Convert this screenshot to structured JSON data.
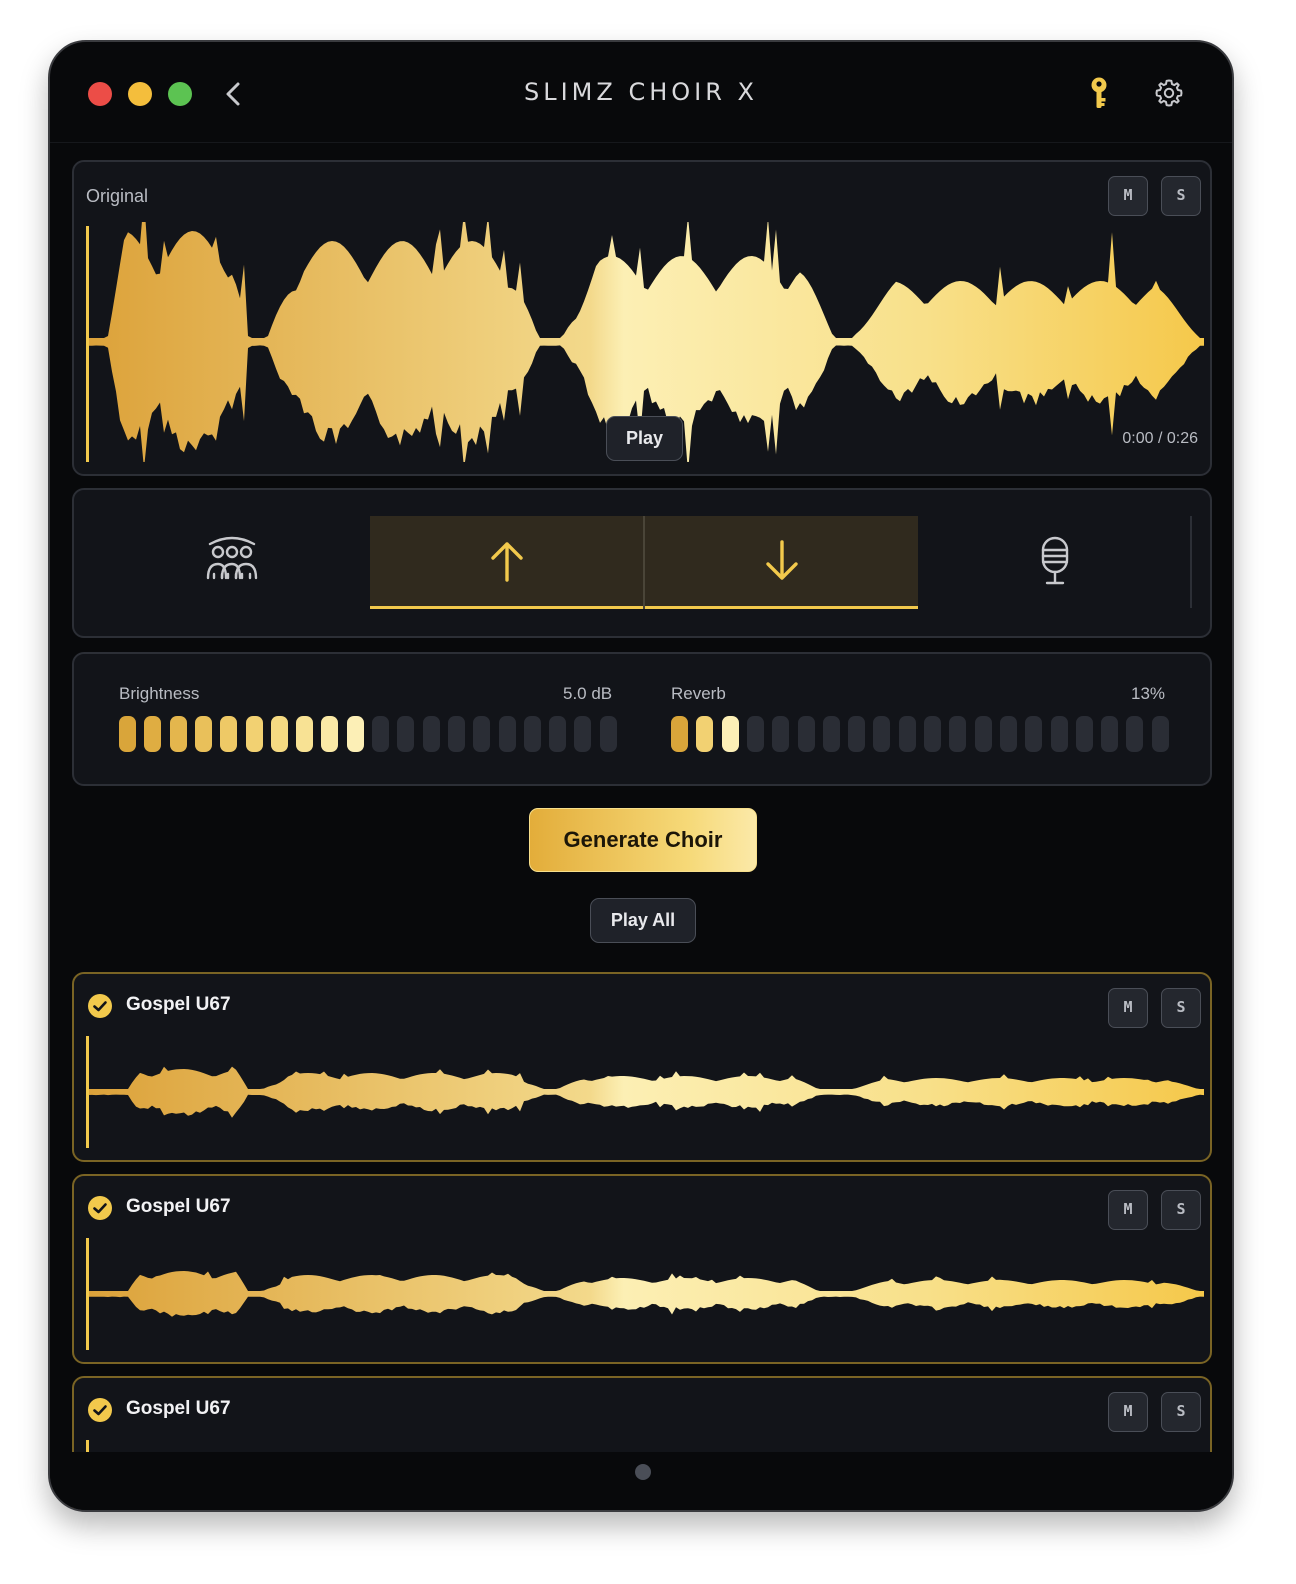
{
  "app": {
    "title": "SLIMZ CHOIR X"
  },
  "titlebar": {
    "back_icon": "chevron-left-icon",
    "key_icon": "key-icon",
    "settings_icon": "gear-icon"
  },
  "original": {
    "label": "Original",
    "mute_label": "M",
    "solo_label": "S",
    "play_label": "Play",
    "time": "0:00 / 0:26"
  },
  "modes": {
    "items": [
      {
        "icon": "choir-group-icon",
        "selected": false
      },
      {
        "icon": "arrow-up-icon",
        "selected": true
      },
      {
        "icon": "arrow-down-icon",
        "selected": true
      },
      {
        "icon": "microphone-icon",
        "selected": false
      }
    ]
  },
  "controls": {
    "brightness": {
      "label": "Brightness",
      "value": "5.0 dB",
      "level": 0.5,
      "segments": 20
    },
    "reverb": {
      "label": "Reverb",
      "value": "13%",
      "level": 0.13,
      "segments": 20
    }
  },
  "actions": {
    "generate_label": "Generate Choir",
    "play_all_label": "Play All"
  },
  "tracks": [
    {
      "name": "Gospel U67",
      "checked": true,
      "mute_label": "M",
      "solo_label": "S"
    },
    {
      "name": "Gospel U67",
      "checked": true,
      "mute_label": "M",
      "solo_label": "S"
    },
    {
      "name": "Gospel U67",
      "checked": true,
      "mute_label": "M",
      "solo_label": "S"
    }
  ],
  "colors": {
    "accent": "#f2c94c",
    "accent_dark": "#d9a53a",
    "accent_light": "#fbeaa8",
    "background": "#08090b",
    "panel": "#121419",
    "inactive_segment": "#2a2d35"
  }
}
